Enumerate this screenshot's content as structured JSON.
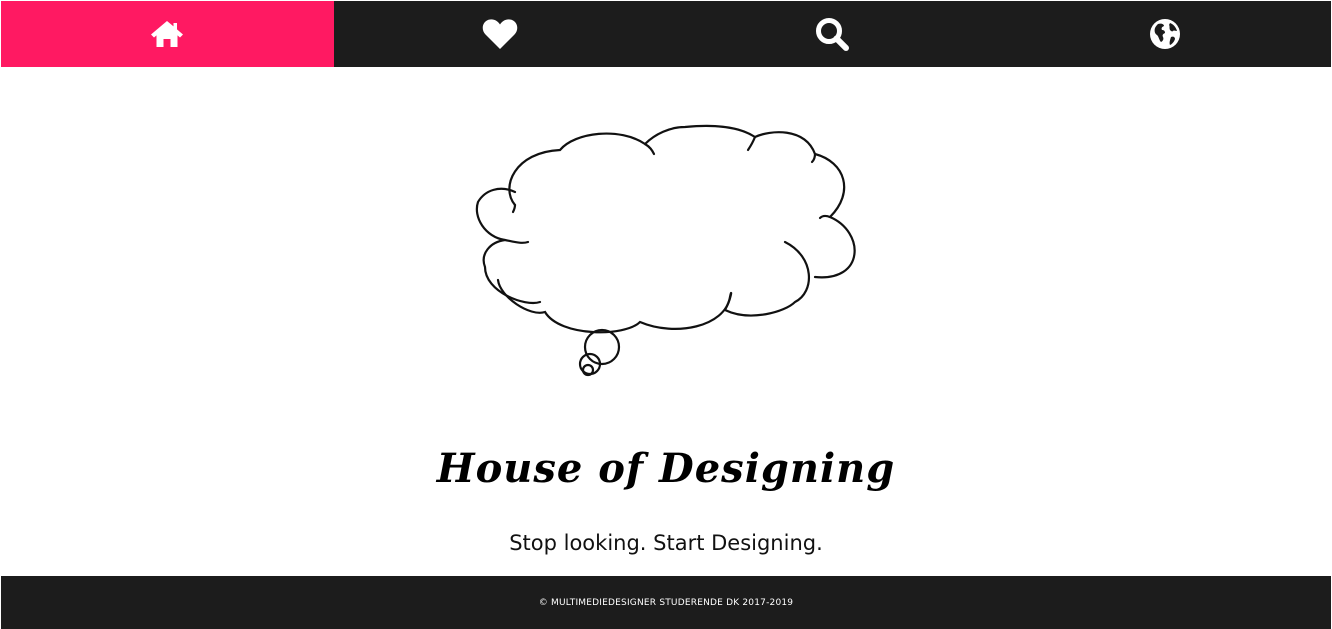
{
  "colors": {
    "nav_background": "#1c1c1c",
    "nav_active": "#ff1962",
    "footer_background": "#1c1c1c",
    "icon_color": "#ffffff"
  },
  "nav": {
    "items": [
      {
        "icon": "home-icon",
        "active": true
      },
      {
        "icon": "heart-icon",
        "active": false
      },
      {
        "icon": "search-icon",
        "active": false
      },
      {
        "icon": "globe-icon",
        "active": false
      }
    ]
  },
  "hero": {
    "illustration": "thought-cloud-icon",
    "title": "House of Designing",
    "tagline": "Stop looking. Start Designing."
  },
  "footer": {
    "copyright": "© MULTIMEDIEDESIGNER STUDERENDE DK 2017-2019"
  }
}
